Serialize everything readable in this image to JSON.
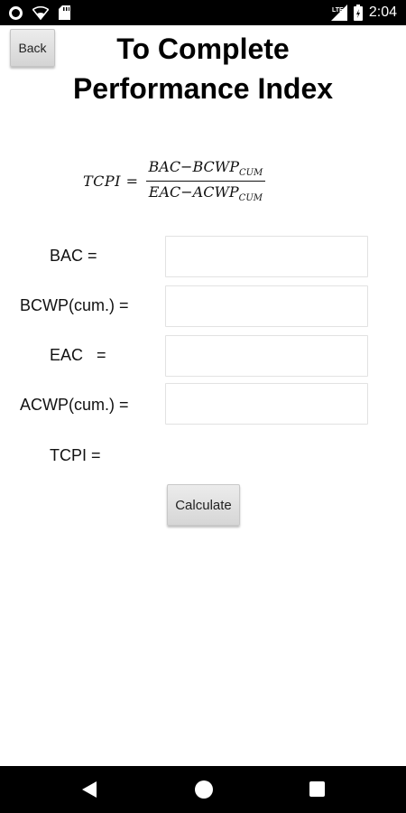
{
  "status_bar": {
    "network_label": "LTE",
    "time": "2:04",
    "icons": [
      "circle-notification-icon",
      "wifi-off-icon",
      "sd-card-icon",
      "cell-signal-icon",
      "battery-icon"
    ]
  },
  "header": {
    "back_label": "Back",
    "title_line1": "To Complete",
    "title_line2": "Performance Index"
  },
  "formula": {
    "lhs": "TCPI =",
    "numerator": "BAC−BCWP",
    "numerator_sub": "CUM",
    "denominator": "EAC−ACWP",
    "denominator_sub": "CUM"
  },
  "form": {
    "fields": [
      {
        "label": "BAC =",
        "value": "",
        "placeholder": ""
      },
      {
        "label": "BCWP(cum.) =",
        "value": "",
        "placeholder": ""
      },
      {
        "label": "EAC   =",
        "value": "",
        "placeholder": ""
      },
      {
        "label": "ACWP(cum.) =",
        "value": "",
        "placeholder": ""
      }
    ],
    "result_label": "TCPI =",
    "calculate_label": "Calculate"
  },
  "nav_bar": {
    "icons": [
      "back-triangle-icon",
      "home-circle-icon",
      "recents-square-icon"
    ]
  },
  "colors": {
    "status_bar_bg": "#000000",
    "page_bg": "#ffffff",
    "button_bg": "#e0e0e0"
  }
}
